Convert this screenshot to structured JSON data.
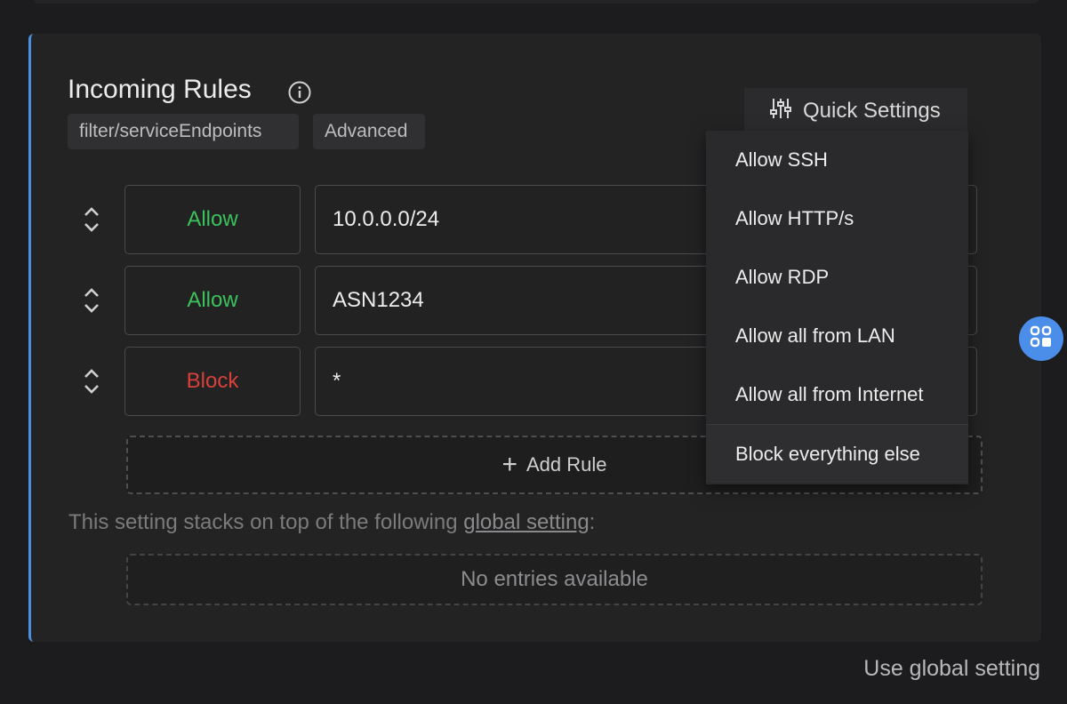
{
  "section": {
    "title": "Incoming Rules",
    "tags": [
      "filter/serviceEndpoints",
      "Advanced"
    ]
  },
  "quick_settings": {
    "label": "Quick Settings",
    "menu": [
      "Allow SSH",
      "Allow HTTP/s",
      "Allow RDP",
      "Allow all from LAN",
      "Allow all from Internet",
      "Block everything else"
    ]
  },
  "rules": [
    {
      "action": "Allow",
      "entity": "10.0.0.0/24",
      "color": "#3bc25b"
    },
    {
      "action": "Allow",
      "entity": "ASN1234",
      "color": "#3bc25b"
    },
    {
      "action": "Block",
      "entity": "*",
      "color": "#d8403a"
    }
  ],
  "add_rule_label": "Add Rule",
  "stack_note": {
    "prefix": "This setting stacks on top of the following ",
    "link": "global setting",
    "suffix": ":"
  },
  "no_entries": "No entries available",
  "use_global": "Use global setting",
  "colors": {
    "accent": "#4b8fe0",
    "allow": "#3bc25b",
    "block": "#d8403a"
  }
}
